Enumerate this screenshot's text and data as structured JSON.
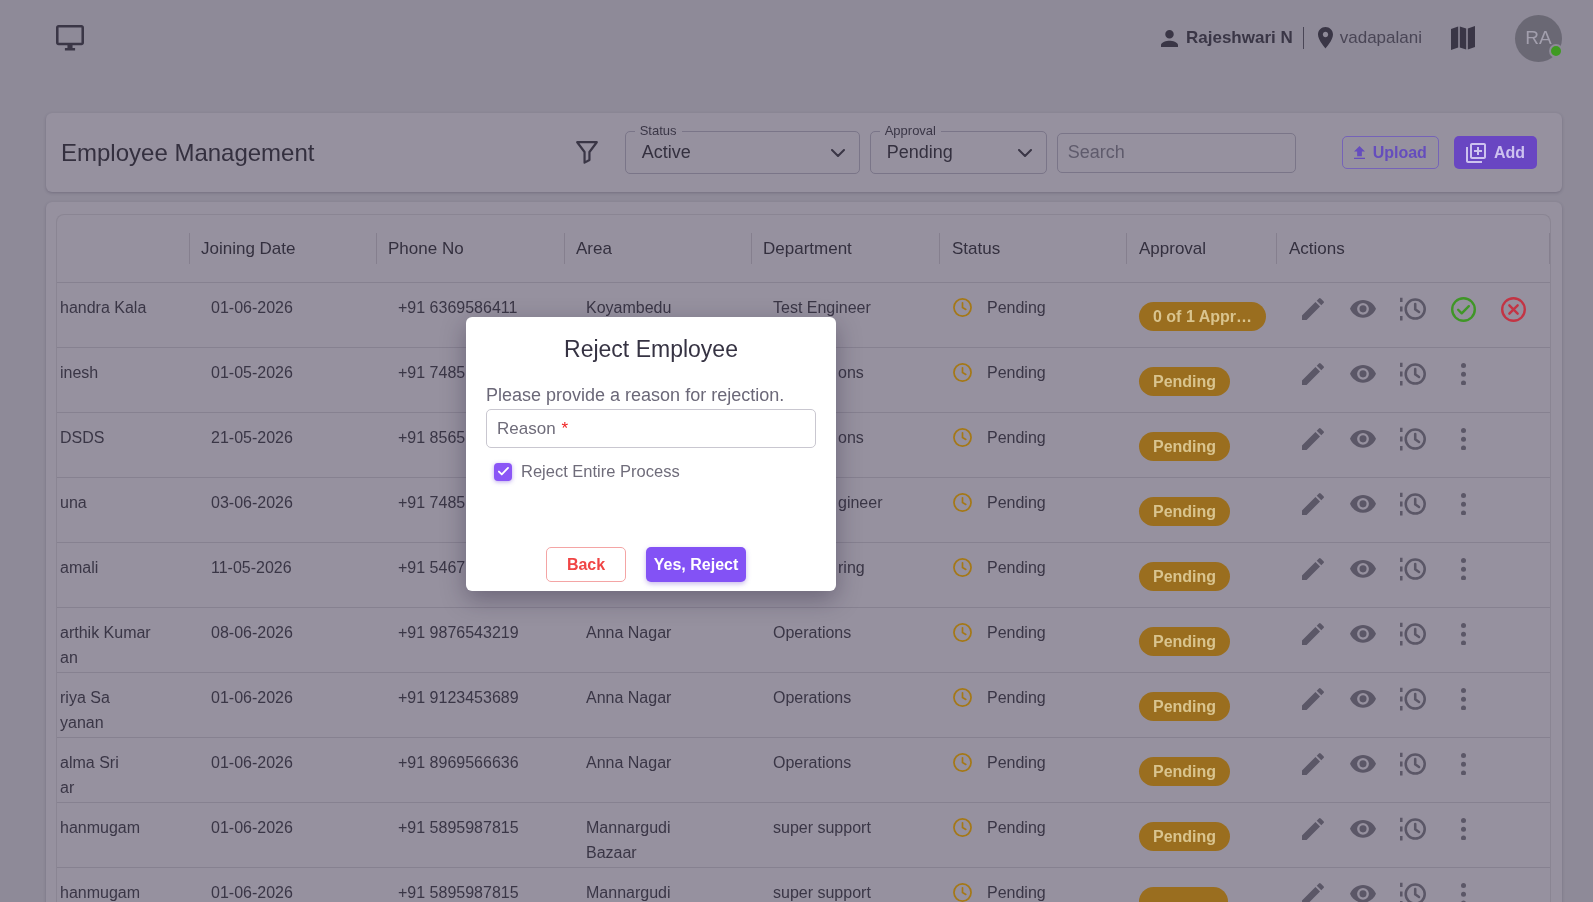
{
  "top_bar": {
    "user_name": "Rajeshwari N",
    "location": "vadapalani",
    "avatar": {
      "initials": "RA",
      "online": true
    }
  },
  "header": {
    "title": "Employee Management",
    "filters": [
      {
        "label": "Status",
        "value": "Active"
      },
      {
        "label": "Approval",
        "value": "Pending"
      }
    ],
    "search": {
      "placeholder": "Search"
    },
    "buttons": [
      {
        "label": "Upload",
        "kind": "upload"
      },
      {
        "label": "Add",
        "kind": "add"
      }
    ]
  },
  "table": {
    "columns": [
      "Joining Date",
      "Phone No",
      "Area",
      "Department",
      "Status",
      "Approval",
      "Actions"
    ],
    "rows": [
      {
        "name": [
          "handra Kala"
        ],
        "joining_date": "01-06-2026",
        "phone": "+91 6369586411",
        "area": "Koyambedu",
        "department": "Test Engineer",
        "status": "Pending",
        "approval": "0 of 1 Appr…",
        "actions": [
          {
            "kind": "edit"
          },
          {
            "kind": "view"
          },
          {
            "kind": "history"
          },
          {
            "kind": "approve"
          },
          {
            "kind": "reject"
          }
        ]
      },
      {
        "name": [
          "inesh"
        ],
        "joining_date": "01-05-2026",
        "phone": "+91 7485",
        "department": "ons",
        "status": "Pending",
        "approval": "Pending",
        "actions": [
          {
            "kind": "edit"
          },
          {
            "kind": "view"
          },
          {
            "kind": "history"
          },
          {
            "kind": "more"
          }
        ]
      },
      {
        "name": [
          "DSDS"
        ],
        "joining_date": "21-05-2026",
        "phone": "+91 8565",
        "department": "ons",
        "status": "Pending",
        "approval": "Pending",
        "actions": [
          {
            "kind": "edit"
          },
          {
            "kind": "view"
          },
          {
            "kind": "history"
          },
          {
            "kind": "more"
          }
        ]
      },
      {
        "name": [
          "una"
        ],
        "joining_date": "03-06-2026",
        "phone": "+91 7485",
        "department": "gineer",
        "status": "Pending",
        "approval": "Pending",
        "actions": [
          {
            "kind": "edit"
          },
          {
            "kind": "view"
          },
          {
            "kind": "history"
          },
          {
            "kind": "more"
          }
        ]
      },
      {
        "name": [
          "amali"
        ],
        "joining_date": "11-05-2026",
        "phone": "+91 5467",
        "department": "ring",
        "status": "Pending",
        "approval": "Pending",
        "actions": [
          {
            "kind": "edit"
          },
          {
            "kind": "view"
          },
          {
            "kind": "history"
          },
          {
            "kind": "more"
          }
        ]
      },
      {
        "name": [
          "arthik Kumar",
          "an"
        ],
        "joining_date": "08-06-2026",
        "phone": "+91 9876543219",
        "area": "Anna Nagar",
        "department": "Operations",
        "status": "Pending",
        "approval": "Pending",
        "actions": [
          {
            "kind": "edit"
          },
          {
            "kind": "view"
          },
          {
            "kind": "history"
          },
          {
            "kind": "more"
          }
        ]
      },
      {
        "name": [
          "riya Sa",
          "yanan"
        ],
        "joining_date": "01-06-2026",
        "phone": "+91 9123453689",
        "area": "Anna Nagar",
        "department": "Operations",
        "status": "Pending",
        "approval": "Pending",
        "actions": [
          {
            "kind": "edit"
          },
          {
            "kind": "view"
          },
          {
            "kind": "history"
          },
          {
            "kind": "more"
          }
        ]
      },
      {
        "name": [
          "alma Sri",
          "ar"
        ],
        "joining_date": "01-06-2026",
        "phone": "+91 8969566636",
        "area": "Anna Nagar",
        "department": "Operations",
        "status": "Pending",
        "approval": "Pending",
        "actions": [
          {
            "kind": "edit"
          },
          {
            "kind": "view"
          },
          {
            "kind": "history"
          },
          {
            "kind": "more"
          }
        ]
      },
      {
        "name": [
          "hanmugam"
        ],
        "joining_date": "01-06-2026",
        "phone": "+91 5895987815",
        "area": "Mannargudi Bazaar",
        "department": "super support",
        "status": "Pending",
        "approval": "Pending",
        "actions": [
          {
            "kind": "edit"
          },
          {
            "kind": "view"
          },
          {
            "kind": "history"
          },
          {
            "kind": "more"
          }
        ]
      },
      {
        "name": [
          "hanmugam"
        ],
        "joining_date": "01-06-2026",
        "phone": "+91 5895987815",
        "area": "Mannargudi",
        "department": "super support",
        "status": "Pending",
        "actions": [
          {
            "kind": "edit"
          },
          {
            "kind": "view"
          },
          {
            "kind": "history"
          },
          {
            "kind": "more"
          }
        ]
      }
    ]
  },
  "dialog": {
    "title": "Reject Employee",
    "message": "Please provide a reason for rejection.",
    "reason_field": {
      "label": "Reason",
      "required_mark": "*"
    },
    "checkbox": {
      "label": "Reject Entire Process",
      "checked": true
    },
    "buttons": [
      {
        "label": "Back",
        "kind": "back"
      },
      {
        "label": "Yes, Reject",
        "kind": "confirm"
      }
    ]
  }
}
